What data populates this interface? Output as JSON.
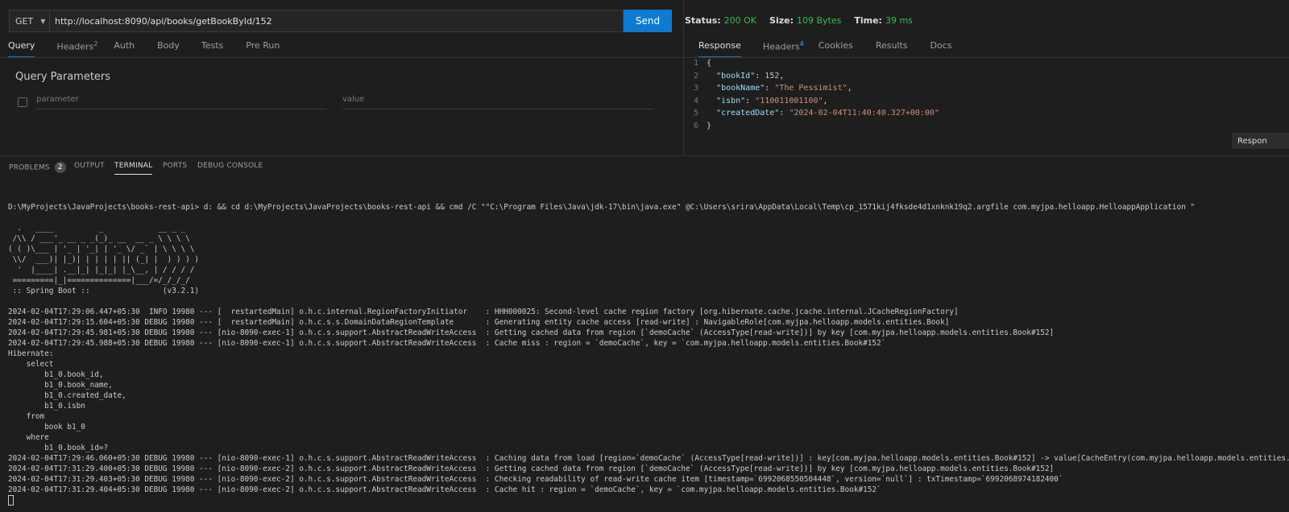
{
  "request": {
    "method": "GET",
    "url": "http://localhost:8090/api/books/getBookById/152",
    "send_label": "Send",
    "tabs": [
      {
        "label": "Query",
        "sup": ""
      },
      {
        "label": "Headers",
        "sup": "2"
      },
      {
        "label": "Auth",
        "sup": ""
      },
      {
        "label": "Body",
        "sup": ""
      },
      {
        "label": "Tests",
        "sup": ""
      },
      {
        "label": "Pre Run",
        "sup": ""
      }
    ],
    "query_title": "Query Parameters",
    "param_placeholder": "parameter",
    "value_placeholder": "value"
  },
  "response": {
    "status_label": "Status:",
    "status_value": "200 OK",
    "size_label": "Size:",
    "size_value": "109 Bytes",
    "time_label": "Time:",
    "time_value": "39 ms",
    "tabs": [
      {
        "label": "Response",
        "sup": ""
      },
      {
        "label": "Headers",
        "sup": "4"
      },
      {
        "label": "Cookies",
        "sup": ""
      },
      {
        "label": "Results",
        "sup": ""
      },
      {
        "label": "Docs",
        "sup": ""
      }
    ],
    "line_numbers": [
      "1",
      "2",
      "3",
      "4",
      "5",
      "6"
    ],
    "json": {
      "open": "{",
      "close": "}",
      "fields": [
        {
          "key": "\"bookId\"",
          "value": "152",
          "type": "n",
          "comma": ","
        },
        {
          "key": "\"bookName\"",
          "value": "\"The Pessimist\"",
          "type": "s",
          "comma": ","
        },
        {
          "key": "\"isbn\"",
          "value": "\"110011001100\"",
          "type": "s",
          "comma": ","
        },
        {
          "key": "\"createdDate\"",
          "value": "\"2024-02-04T11:40:40.327+00:00\"",
          "type": "s",
          "comma": ""
        }
      ]
    },
    "side_badge": "Respon"
  },
  "panel": {
    "tabs": [
      "PROBLEMS",
      "OUTPUT",
      "TERMINAL",
      "PORTS",
      "DEBUG CONSOLE"
    ],
    "problems_count": "2"
  },
  "terminal": {
    "lines": [
      "",
      "D:\\MyProjects\\JavaProjects\\books-rest-api> d: && cd d:\\MyProjects\\JavaProjects\\books-rest-api && cmd /C \"\"C:\\Program Files\\Java\\jdk-17\\bin\\java.exe\" @C:\\Users\\srira\\AppData\\Local\\Temp\\cp_1571kij4fksde4d1xnknk19q2.argfile com.myjpa.helloapp.HelloappApplication \"",
      "",
      "  .   ____          _            __ _ _",
      " /\\\\ / ___'_ __ _ _(_)_ __  __ _ \\ \\ \\ \\",
      "( ( )\\___ | '_ | '_| | '_ \\/ _` | \\ \\ \\ \\",
      " \\\\/  ___)| |_)| | | | | || (_| |  ) ) ) )",
      "  '  |____| .__|_| |_|_| |_\\__, | / / / /",
      " =========|_|==============|___/=/_/_/_/",
      " :: Spring Boot ::                (v3.2.1)",
      "",
      "2024-02-04T17:29:06.447+05:30  INFO 19980 --- [  restartedMain] o.h.c.internal.RegionFactoryInitiator    : HHH000025: Second-level cache region factory [org.hibernate.cache.jcache.internal.JCacheRegionFactory]",
      "2024-02-04T17:29:15.604+05:30 DEBUG 19980 --- [  restartedMain] o.h.c.s.s.DomainDataRegionTemplate       : Generating entity cache access [read-write] : NavigableRole[com.myjpa.helloapp.models.entities.Book]",
      "2024-02-04T17:29:45.981+05:30 DEBUG 19980 --- [nio-8090-exec-1] o.h.c.s.support.AbstractReadWriteAccess  : Getting cached data from region [`demoCache` (AccessType[read-write])] by key [com.myjpa.helloapp.models.entities.Book#152]",
      "2024-02-04T17:29:45.988+05:30 DEBUG 19980 --- [nio-8090-exec-1] o.h.c.s.support.AbstractReadWriteAccess  : Cache miss : region = `demoCache`, key = `com.myjpa.helloapp.models.entities.Book#152`",
      "Hibernate:",
      "    select",
      "        b1_0.book_id,",
      "        b1_0.book_name,",
      "        b1_0.created_date,",
      "        b1_0.isbn",
      "    from",
      "        book b1_0",
      "    where",
      "        b1_0.book_id=?",
      "2024-02-04T17:29:46.060+05:30 DEBUG 19980 --- [nio-8090-exec-1] o.h.c.s.support.AbstractReadWriteAccess  : Caching data from load [region=`demoCache` (AccessType[read-write])] : key[com.myjpa.helloapp.models.entities.Book#152] -> value[CacheEntry(com.myjpa.helloapp.models.entities.Book)]",
      "2024-02-04T17:31:29.400+05:30 DEBUG 19980 --- [nio-8090-exec-2] o.h.c.s.support.AbstractReadWriteAccess  : Getting cached data from region [`demoCache` (AccessType[read-write])] by key [com.myjpa.helloapp.models.entities.Book#152]",
      "2024-02-04T17:31:29.403+05:30 DEBUG 19980 --- [nio-8090-exec-2] o.h.c.s.support.AbstractReadWriteAccess  : Checking readability of read-write cache item [timestamp=`6992068550504448`, version=`null`] : txTimestamp=`6992068974182400`",
      "2024-02-04T17:31:29.404+05:30 DEBUG 19980 --- [nio-8090-exec-2] o.h.c.s.support.AbstractReadWriteAccess  : Cache hit : region = `demoCache`, key = `com.myjpa.helloapp.models.entities.Book#152`"
    ]
  }
}
